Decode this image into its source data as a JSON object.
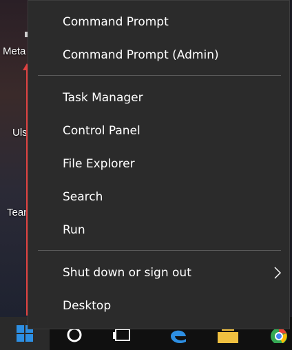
{
  "desktop": {
    "labels": [
      "Meta",
      "Uls",
      "Tean"
    ]
  },
  "menu": {
    "groups": [
      {
        "items": [
          "Command Prompt",
          "Command Prompt (Admin)"
        ]
      },
      {
        "items": [
          "Task Manager",
          "Control Panel",
          "File Explorer",
          "Search",
          "Run"
        ]
      },
      {
        "items": [
          "Shut down or sign out",
          "Desktop"
        ]
      }
    ],
    "submenu_indicator": "chevron-right-icon"
  },
  "taskbar": {
    "icons": [
      "windows-start-icon",
      "cortana-circle-icon",
      "task-view-icon",
      "edge-icon",
      "store-icon",
      "chrome-icon"
    ]
  },
  "colors": {
    "menu_background": "#2b2b2b",
    "separator": "#5a5a5a",
    "text": "#ffffff",
    "annotation_arrow": "#e04040",
    "start_accent": "#2d8fe3"
  }
}
